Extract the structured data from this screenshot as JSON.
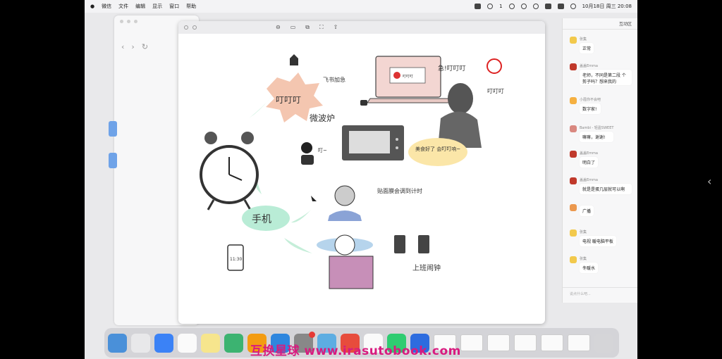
{
  "menubar": {
    "items": [
      "微信",
      "文件",
      "编辑",
      "显示",
      "窗口",
      "帮助"
    ],
    "badge_count": "1",
    "datetime": "10月18日 周三  20:08"
  },
  "viewer": {
    "tools": [
      "⊖",
      "▭",
      "⧉",
      "⛶",
      "⇧"
    ]
  },
  "drawing": {
    "bubble_label": "叮叮叮",
    "top_label": "飞书加急",
    "microwave_label": "微波炉",
    "ding_label": "叮~",
    "screen_text": "叮叮叮",
    "ding_ding": "叮叮叮",
    "boss_label": "急!叮叮叮",
    "food_bubble": "美食好了 会叮叮响~",
    "phone_label": "手机",
    "reminder_label": "贴面膜会调到计时",
    "alarm_label": "上班闹钟",
    "phone_time": "11:30"
  },
  "chat": {
    "header": "互动区",
    "messages": [
      {
        "name": "张集",
        "text": "正常"
      },
      {
        "name": "盖盖Emma",
        "text": "老师，不同是第二段 个剪子吗？想来我的"
      },
      {
        "name": "小蔻你不会吧",
        "text": "数字家!"
      },
      {
        "name": "Bambi - 轻盈SWEET",
        "text": "嘛嘛，谢谢!"
      },
      {
        "name": "盖盖Emma",
        "text": "明白了"
      },
      {
        "name": "盖盖Emma",
        "text": "就是是蛋几层就可以啊"
      },
      {
        "name": "",
        "text": "广播"
      },
      {
        "name": "张集",
        "text": "电视 暖电脑平板"
      },
      {
        "name": "张集",
        "text": "冬暖水"
      }
    ],
    "input_placeholder": "说点什么吧..."
  },
  "watermark": "互换星球 www.irasutobook.com",
  "colors": {
    "accent_pink": "#d81b7f",
    "bubble_pink": "#f4c6b0",
    "phone_green": "#b9ecd6"
  }
}
